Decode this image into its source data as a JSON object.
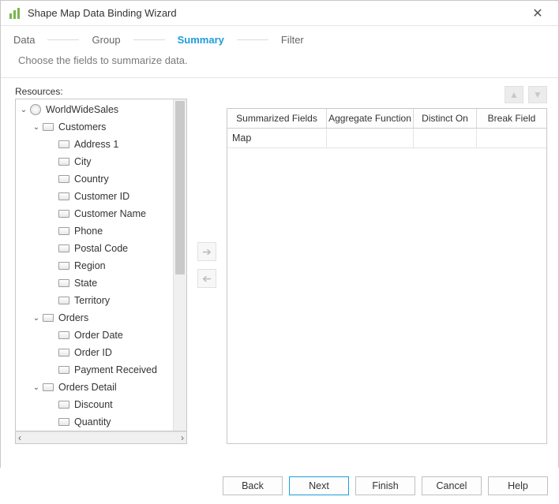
{
  "window": {
    "title": "Shape Map Data Binding Wizard"
  },
  "steps": {
    "data": "Data",
    "group": "Group",
    "summary": "Summary",
    "filter": "Filter",
    "active": "summary"
  },
  "instruction": "Choose the fields to summarize data.",
  "resources": {
    "label": "Resources:",
    "root": "WorldWideSales",
    "tables": [
      {
        "name": "Customers",
        "fields": [
          "Address 1",
          "City",
          "Country",
          "Customer ID",
          "Customer Name",
          "Phone",
          "Postal Code",
          "Region",
          "State",
          "Territory"
        ]
      },
      {
        "name": "Orders",
        "fields": [
          "Order Date",
          "Order ID",
          "Payment Received"
        ]
      },
      {
        "name": "Orders Detail",
        "fields": [
          "Discount",
          "Quantity"
        ]
      }
    ]
  },
  "grid": {
    "headers": {
      "summarized": "Summarized Fields",
      "aggregate": "Aggregate Function",
      "distinct": "Distinct On",
      "break": "Break Field"
    },
    "rows": [
      {
        "summarized": "Map",
        "aggregate": "",
        "distinct": "",
        "break": ""
      }
    ]
  },
  "buttons": {
    "back": "Back",
    "next": "Next",
    "finish": "Finish",
    "cancel": "Cancel",
    "help": "Help"
  }
}
